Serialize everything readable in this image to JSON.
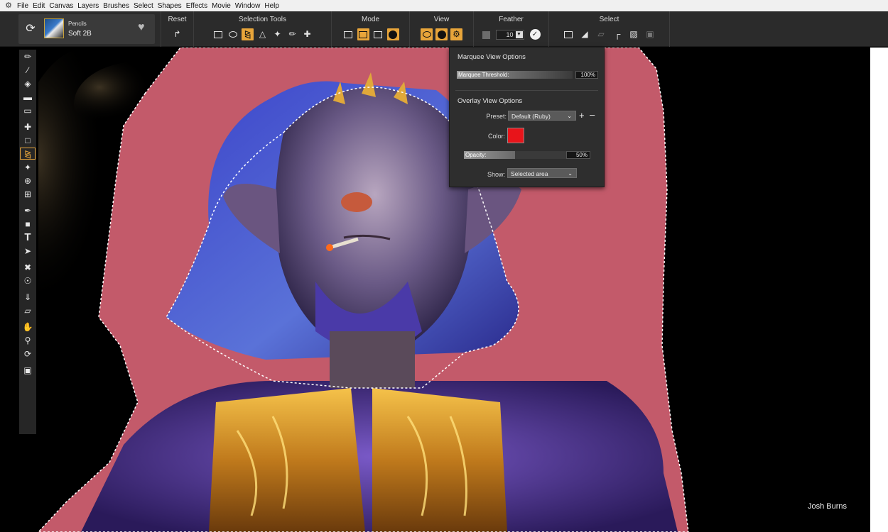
{
  "menu": {
    "items": [
      "File",
      "Edit",
      "Canvas",
      "Layers",
      "Brushes",
      "Select",
      "Shapes",
      "Effects",
      "Movie",
      "Window",
      "Help"
    ]
  },
  "brush": {
    "category": "Pencils",
    "variant": "Soft 2B"
  },
  "property_bar": {
    "reset_title": "Reset",
    "selection_tools_title": "Selection Tools",
    "mode_title": "Mode",
    "view_title": "View",
    "feather_title": "Feather",
    "feather_value": "10",
    "select_title": "Select"
  },
  "popup": {
    "marquee_title": "Marquee View Options",
    "threshold_label": "Marquee Threshold:",
    "threshold_value": "100%",
    "threshold_fraction": 1.0,
    "overlay_title": "Overlay View Options",
    "preset_label": "Preset:",
    "preset_value": "Default (Ruby)",
    "color_label": "Color:",
    "overlay_color": "#e8141a",
    "opacity_label": "Opacity:",
    "opacity_value": "50%",
    "opacity_fraction": 0.5,
    "show_label": "Show:",
    "show_value": "Selected area"
  },
  "canvas": {
    "credit": "Josh Burns",
    "overlay_color": "#c35a6a"
  },
  "colors": {
    "accent": "#e8a53a",
    "panel": "#2b2b2b"
  }
}
